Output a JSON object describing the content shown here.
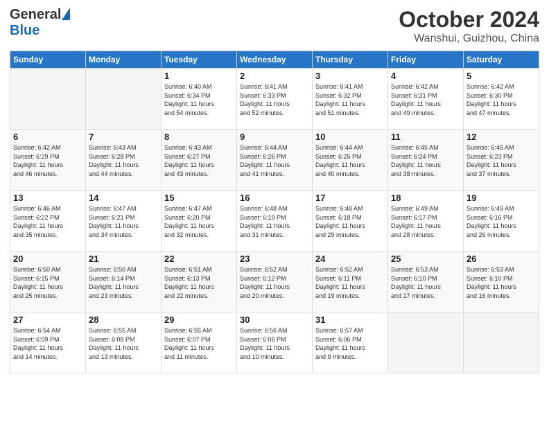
{
  "header": {
    "logo_general": "General",
    "logo_blue": "Blue",
    "month_title": "October 2024",
    "location": "Wanshui, Guizhou, China"
  },
  "days_of_week": [
    "Sunday",
    "Monday",
    "Tuesday",
    "Wednesday",
    "Thursday",
    "Friday",
    "Saturday"
  ],
  "weeks": [
    [
      {
        "day": "",
        "info": ""
      },
      {
        "day": "",
        "info": ""
      },
      {
        "day": "1",
        "info": "Sunrise: 6:40 AM\nSunset: 6:34 PM\nDaylight: 11 hours\nand 54 minutes."
      },
      {
        "day": "2",
        "info": "Sunrise: 6:41 AM\nSunset: 6:33 PM\nDaylight: 11 hours\nand 52 minutes."
      },
      {
        "day": "3",
        "info": "Sunrise: 6:41 AM\nSunset: 6:32 PM\nDaylight: 11 hours\nand 51 minutes."
      },
      {
        "day": "4",
        "info": "Sunrise: 6:42 AM\nSunset: 6:31 PM\nDaylight: 11 hours\nand 49 minutes."
      },
      {
        "day": "5",
        "info": "Sunrise: 6:42 AM\nSunset: 6:30 PM\nDaylight: 11 hours\nand 47 minutes."
      }
    ],
    [
      {
        "day": "6",
        "info": "Sunrise: 6:42 AM\nSunset: 6:29 PM\nDaylight: 11 hours\nand 46 minutes."
      },
      {
        "day": "7",
        "info": "Sunrise: 6:43 AM\nSunset: 6:28 PM\nDaylight: 11 hours\nand 44 minutes."
      },
      {
        "day": "8",
        "info": "Sunrise: 6:43 AM\nSunset: 6:27 PM\nDaylight: 11 hours\nand 43 minutes."
      },
      {
        "day": "9",
        "info": "Sunrise: 6:44 AM\nSunset: 6:26 PM\nDaylight: 11 hours\nand 41 minutes."
      },
      {
        "day": "10",
        "info": "Sunrise: 6:44 AM\nSunset: 6:25 PM\nDaylight: 11 hours\nand 40 minutes."
      },
      {
        "day": "11",
        "info": "Sunrise: 6:45 AM\nSunset: 6:24 PM\nDaylight: 11 hours\nand 38 minutes."
      },
      {
        "day": "12",
        "info": "Sunrise: 6:45 AM\nSunset: 6:23 PM\nDaylight: 11 hours\nand 37 minutes."
      }
    ],
    [
      {
        "day": "13",
        "info": "Sunrise: 6:46 AM\nSunset: 6:22 PM\nDaylight: 11 hours\nand 35 minutes."
      },
      {
        "day": "14",
        "info": "Sunrise: 6:47 AM\nSunset: 6:21 PM\nDaylight: 11 hours\nand 34 minutes."
      },
      {
        "day": "15",
        "info": "Sunrise: 6:47 AM\nSunset: 6:20 PM\nDaylight: 11 hours\nand 32 minutes."
      },
      {
        "day": "16",
        "info": "Sunrise: 6:48 AM\nSunset: 6:19 PM\nDaylight: 11 hours\nand 31 minutes."
      },
      {
        "day": "17",
        "info": "Sunrise: 6:48 AM\nSunset: 6:18 PM\nDaylight: 11 hours\nand 29 minutes."
      },
      {
        "day": "18",
        "info": "Sunrise: 6:49 AM\nSunset: 6:17 PM\nDaylight: 11 hours\nand 28 minutes."
      },
      {
        "day": "19",
        "info": "Sunrise: 6:49 AM\nSunset: 6:16 PM\nDaylight: 11 hours\nand 26 minutes."
      }
    ],
    [
      {
        "day": "20",
        "info": "Sunrise: 6:50 AM\nSunset: 6:15 PM\nDaylight: 11 hours\nand 25 minutes."
      },
      {
        "day": "21",
        "info": "Sunrise: 6:50 AM\nSunset: 6:14 PM\nDaylight: 11 hours\nand 23 minutes."
      },
      {
        "day": "22",
        "info": "Sunrise: 6:51 AM\nSunset: 6:13 PM\nDaylight: 11 hours\nand 22 minutes."
      },
      {
        "day": "23",
        "info": "Sunrise: 6:52 AM\nSunset: 6:12 PM\nDaylight: 11 hours\nand 20 minutes."
      },
      {
        "day": "24",
        "info": "Sunrise: 6:52 AM\nSunset: 6:11 PM\nDaylight: 11 hours\nand 19 minutes."
      },
      {
        "day": "25",
        "info": "Sunrise: 6:53 AM\nSunset: 6:10 PM\nDaylight: 11 hours\nand 17 minutes."
      },
      {
        "day": "26",
        "info": "Sunrise: 6:53 AM\nSunset: 6:10 PM\nDaylight: 11 hours\nand 16 minutes."
      }
    ],
    [
      {
        "day": "27",
        "info": "Sunrise: 6:54 AM\nSunset: 6:09 PM\nDaylight: 11 hours\nand 14 minutes."
      },
      {
        "day": "28",
        "info": "Sunrise: 6:55 AM\nSunset: 6:08 PM\nDaylight: 11 hours\nand 13 minutes."
      },
      {
        "day": "29",
        "info": "Sunrise: 6:55 AM\nSunset: 6:07 PM\nDaylight: 11 hours\nand 11 minutes."
      },
      {
        "day": "30",
        "info": "Sunrise: 6:56 AM\nSunset: 6:06 PM\nDaylight: 11 hours\nand 10 minutes."
      },
      {
        "day": "31",
        "info": "Sunrise: 6:57 AM\nSunset: 6:06 PM\nDaylight: 11 hours\nand 9 minutes."
      },
      {
        "day": "",
        "info": ""
      },
      {
        "day": "",
        "info": ""
      }
    ]
  ]
}
